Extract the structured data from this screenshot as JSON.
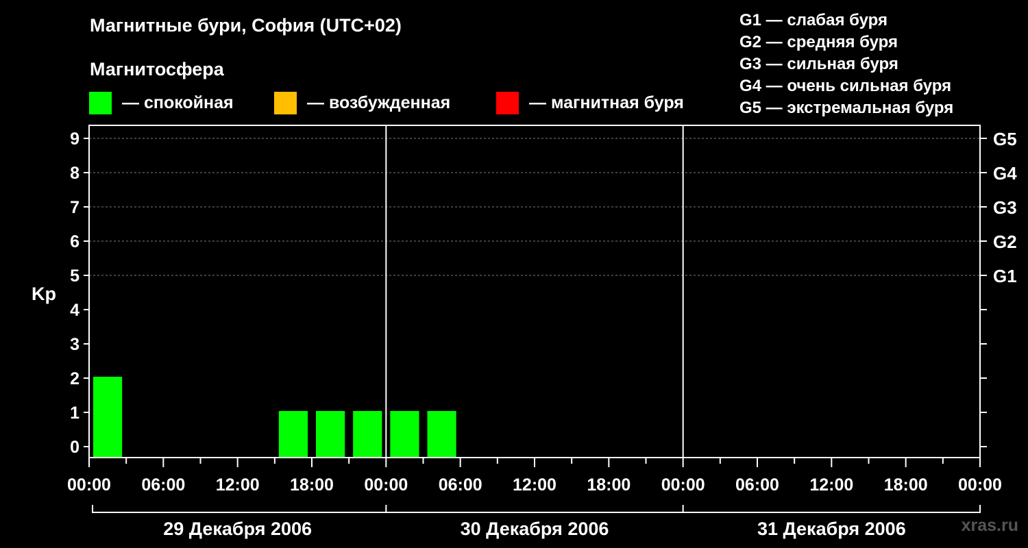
{
  "header": {
    "title": "Магнитные бури, София (UTC+02)",
    "subtitle": "Магнитосфера"
  },
  "legend": {
    "items": [
      {
        "label": "— спокойная",
        "color": "#00ff00"
      },
      {
        "label": "— возбужденная",
        "color": "#ffbf00"
      },
      {
        "label": "— магнитная буря",
        "color": "#ff0000"
      }
    ]
  },
  "g_legend": [
    "G1 — слабая буря",
    "G2 — средняя буря",
    "G3 — сильная буря",
    "G4 — очень сильная буря",
    "G5 — экстремальная буря"
  ],
  "watermark": "xras.ru",
  "chart_data": {
    "type": "bar",
    "ylabel": "Kp",
    "ylim": [
      0,
      9
    ],
    "yticks": [
      "0",
      "1",
      "2",
      "3",
      "4",
      "5",
      "6",
      "7",
      "8",
      "9"
    ],
    "right_ticks": [
      {
        "value": 5,
        "label": "G1"
      },
      {
        "value": 6,
        "label": "G2"
      },
      {
        "value": 7,
        "label": "G3"
      },
      {
        "value": 8,
        "label": "G4"
      },
      {
        "value": 9,
        "label": "G5"
      }
    ],
    "grid": "dashed at Kp 5-9",
    "xtick_labels": [
      "00:00",
      "06:00",
      "12:00",
      "18:00",
      "00:00",
      "06:00",
      "12:00",
      "18:00",
      "00:00",
      "06:00",
      "12:00",
      "18:00",
      "00:00"
    ],
    "days": [
      "29 Декабря 2006",
      "30 Декабря 2006",
      "31 Декабря 2006"
    ],
    "bar_interval_hours": 3,
    "bars": [
      {
        "start_hour": 0,
        "value": 2,
        "status": "спокойная"
      },
      {
        "start_hour": 15,
        "value": 1,
        "status": "спокойная"
      },
      {
        "start_hour": 18,
        "value": 1,
        "status": "спокойная"
      },
      {
        "start_hour": 21,
        "value": 1,
        "status": "спокойная"
      },
      {
        "start_hour": 24,
        "value": 1,
        "status": "спокойная"
      },
      {
        "start_hour": 27,
        "value": 1,
        "status": "спокойная"
      }
    ],
    "colors": {
      "calm": "#00ff00",
      "disturbed": "#ffbf00",
      "storm": "#ff0000",
      "axis": "#ffffff",
      "grid": "#808080"
    }
  }
}
